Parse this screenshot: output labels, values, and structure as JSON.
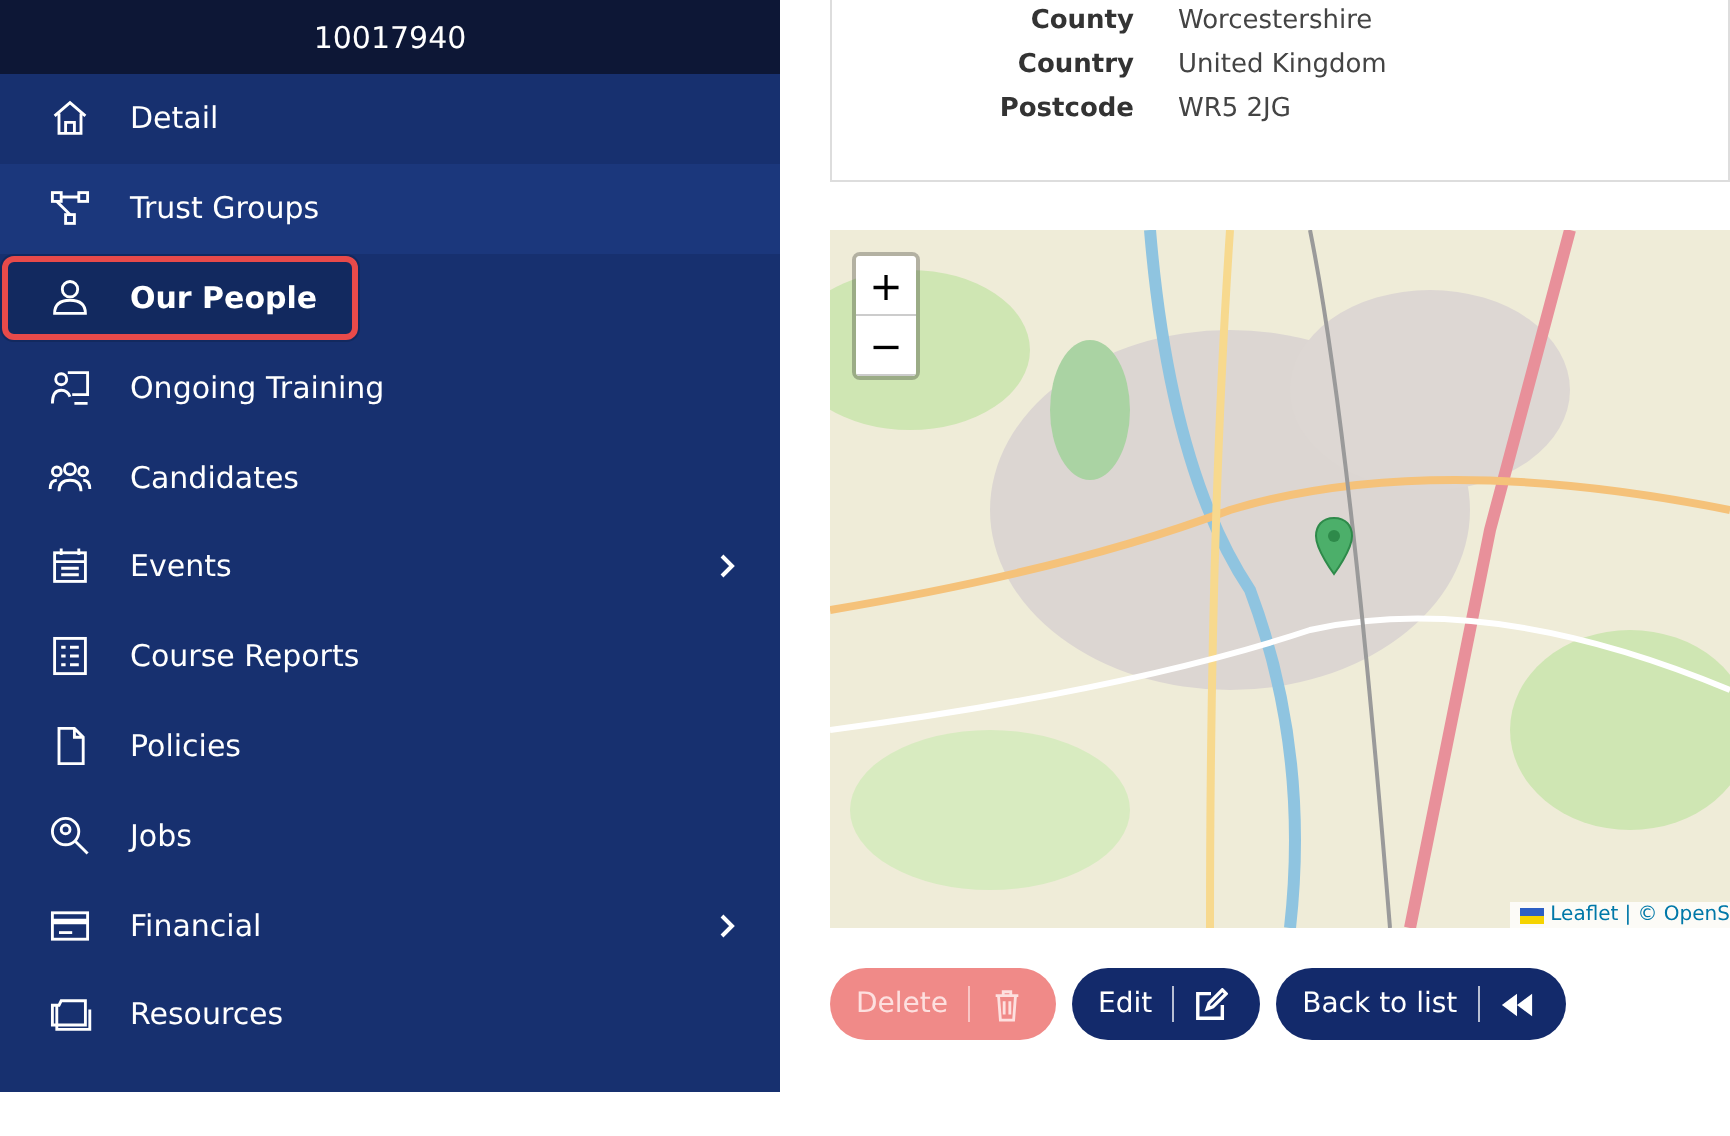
{
  "sidebar": {
    "header": "10017940",
    "items": [
      {
        "label": "Detail",
        "selected": false,
        "kind": "link"
      },
      {
        "label": "Trust Groups",
        "selected": false,
        "kind": "link"
      },
      {
        "label": "Our People",
        "selected": true,
        "kind": "link"
      },
      {
        "label": "Ongoing Training",
        "selected": false,
        "kind": "link"
      },
      {
        "label": "Candidates",
        "selected": false,
        "kind": "link"
      },
      {
        "label": "Events",
        "selected": false,
        "kind": "submenu"
      },
      {
        "label": "Course Reports",
        "selected": false,
        "kind": "link"
      },
      {
        "label": "Policies",
        "selected": false,
        "kind": "link"
      },
      {
        "label": "Jobs",
        "selected": false,
        "kind": "link"
      },
      {
        "label": "Financial",
        "selected": false,
        "kind": "submenu"
      },
      {
        "label": "Resources",
        "selected": false,
        "kind": "link"
      }
    ]
  },
  "address": [
    {
      "label": "County",
      "value": "Worcestershire"
    },
    {
      "label": "Country",
      "value": "United Kingdom"
    },
    {
      "label": "Postcode",
      "value": "WR5 2JG"
    }
  ],
  "map": {
    "zoom_in": "+",
    "zoom_out": "−",
    "attribution_link": "Leaflet",
    "attribution_rest": "| © OpenS"
  },
  "buttons": [
    {
      "label": "Delete",
      "kind": "delete",
      "disabled": true
    },
    {
      "label": "Edit",
      "kind": "edit",
      "disabled": false
    },
    {
      "label": "Back to list",
      "kind": "back",
      "disabled": false
    }
  ]
}
